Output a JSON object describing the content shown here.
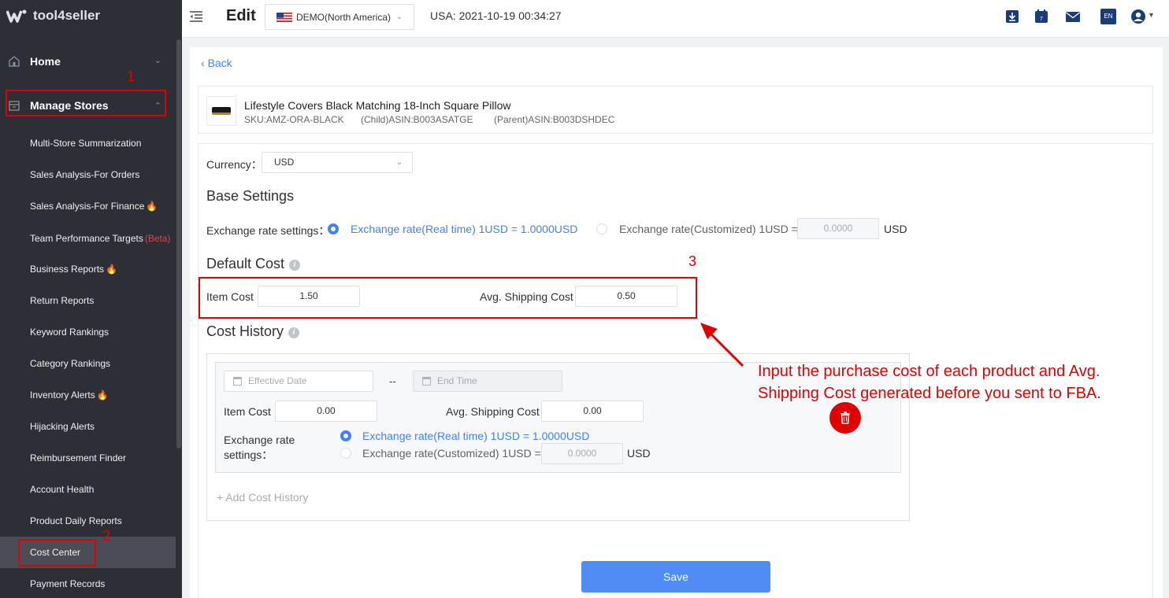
{
  "app": {
    "name": "tool4seller"
  },
  "sidebar": {
    "home_label": "Home",
    "manage_stores_label": "Manage Stores",
    "items": [
      {
        "label": "Multi-Store Summarization"
      },
      {
        "label": "Sales Analysis-For Orders"
      },
      {
        "label": "Sales Analysis-For Finance"
      },
      {
        "label": "Team Performance Targets",
        "badge": "(Beta)"
      },
      {
        "label": "Business Reports"
      },
      {
        "label": "Return Reports"
      },
      {
        "label": "Keyword Rankings"
      },
      {
        "label": "Category Rankings"
      },
      {
        "label": "Inventory Alerts"
      },
      {
        "label": "Hijacking Alerts"
      },
      {
        "label": "Reimbursement Finder"
      },
      {
        "label": "Account Health"
      },
      {
        "label": "Product Daily Reports"
      },
      {
        "label": "Cost Center",
        "active": true
      },
      {
        "label": "Payment Records"
      }
    ]
  },
  "topbar": {
    "title": "Edit",
    "store": "DEMO(North America)",
    "datetime": "USA: 2021-10-19 00:34:27",
    "language": "EN",
    "calendar_day": "7",
    "icons": [
      "download-icon",
      "calendar-icon",
      "mail-icon",
      "language-icon",
      "user-avatar-icon"
    ]
  },
  "back_label": "Back",
  "product": {
    "name": "Lifestyle Covers Black Matching 18-Inch Square Pillow",
    "sku": "SKU:AMZ-ORA-BLACK",
    "child_asin": "(Child)ASIN:B003ASATGE",
    "parent_asin": "(Parent)ASIN:B003DSHDEC"
  },
  "form": {
    "currency_label": "Currency：",
    "currency_value": "USD",
    "base_settings_title": "Base Settings",
    "exchange_label": "Exchange rate settings：",
    "exchange_realtime": "Exchange rate(Real time) 1USD = 1.0000USD",
    "exchange_custom": "Exchange rate(Customized) 1USD =",
    "exchange_custom_value": "0.0000",
    "exchange_unit": "USD",
    "default_cost_title": "Default Cost",
    "item_cost_label": "Item Cost",
    "item_cost_value": "1.50",
    "shipping_cost_label": "Avg. Shipping Cost",
    "shipping_cost_value": "0.50",
    "cost_history_title": "Cost History",
    "history": {
      "effective_date_placeholder": "Effective Date",
      "separator": "--",
      "end_time_placeholder": "End Time",
      "item_cost_label": "Item Cost",
      "item_cost_value": "0.00",
      "shipping_cost_label": "Avg. Shipping Cost",
      "shipping_cost_value": "0.00",
      "exchange_label_1": "Exchange rate",
      "exchange_label_2": "settings：",
      "exchange_realtime": "Exchange rate(Real time) 1USD = 1.0000USD",
      "exchange_custom": "Exchange rate(Customized) 1USD =",
      "exchange_custom_value": "0.0000",
      "exchange_unit": "USD"
    },
    "add_history_label": "Add Cost History",
    "save_label": "Save"
  },
  "annotations": {
    "num1": "1",
    "num2": "2",
    "num3": "3",
    "text": "Input the purchase cost of each product and Avg. Shipping Cost generated before you sent to FBA.",
    "color": "#e30000"
  },
  "colors": {
    "accent": "#4080ff",
    "sidebar_bg": "#2c2f36",
    "save_button": "#4f8df5"
  }
}
